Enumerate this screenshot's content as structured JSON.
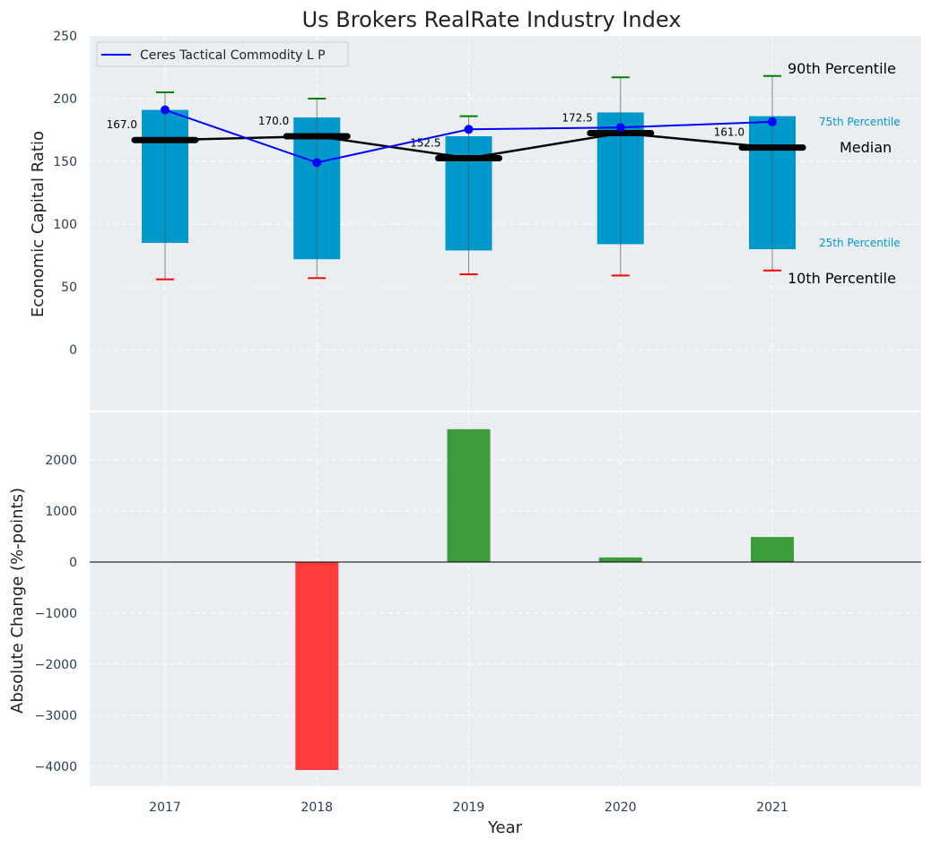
{
  "chart_data": [
    {
      "type": "box",
      "title": "Us Brokers RealRate Industry Index",
      "xlabel": "",
      "ylabel": "Economic Capital Ratio",
      "ylim": [
        -48,
        250
      ],
      "yticks": [
        0,
        50,
        100,
        150,
        200,
        250
      ],
      "grid": true,
      "legend": {
        "placement": "top-left",
        "entries": [
          "Ceres Tactical Commodity L P"
        ]
      },
      "categories": [
        "2017",
        "2018",
        "2019",
        "2020",
        "2021"
      ],
      "p10": [
        56,
        57,
        60,
        59,
        63
      ],
      "p25": [
        85,
        72,
        79,
        84,
        80
      ],
      "median": [
        167.0,
        170.0,
        152.5,
        172.5,
        161.0
      ],
      "median_labels": [
        "167.0",
        "170.0",
        "152.5",
        "172.5",
        "161.0"
      ],
      "p75": [
        191,
        185,
        170,
        189,
        186
      ],
      "p90": [
        205,
        200,
        186,
        217,
        218
      ],
      "series": [
        {
          "name": "Ceres Tactical Commodity L P",
          "values": [
            191,
            149,
            175.5,
            177,
            181.5
          ],
          "color": "#0000ff"
        }
      ],
      "annotations": [
        "90th Percentile",
        "75th Percentile",
        "Median",
        "25th Percentile",
        "10th Percentile"
      ],
      "colors": {
        "box": "#0099cc",
        "p90": "#008000",
        "p10": "#ff0000",
        "median": "#000000",
        "background": "#eaeef0"
      }
    },
    {
      "type": "bar",
      "xlabel": "Year",
      "ylabel": "Absolute Change (%-points)",
      "ylim": [
        -4400,
        2930
      ],
      "yticks": [
        -4000,
        -3000,
        -2000,
        -1000,
        0,
        1000,
        2000
      ],
      "ytick_labels": [
        "−4000",
        "−3000",
        "−2000",
        "−1000",
        "0",
        "1000",
        "2000"
      ],
      "grid": true,
      "categories": [
        "2017",
        "2018",
        "2019",
        "2020",
        "2021"
      ],
      "values": [
        0,
        -4070,
        2600,
        90,
        490
      ],
      "colors": {
        "positive": "#3a9c3a",
        "negative": "#ff3b3b"
      }
    }
  ]
}
